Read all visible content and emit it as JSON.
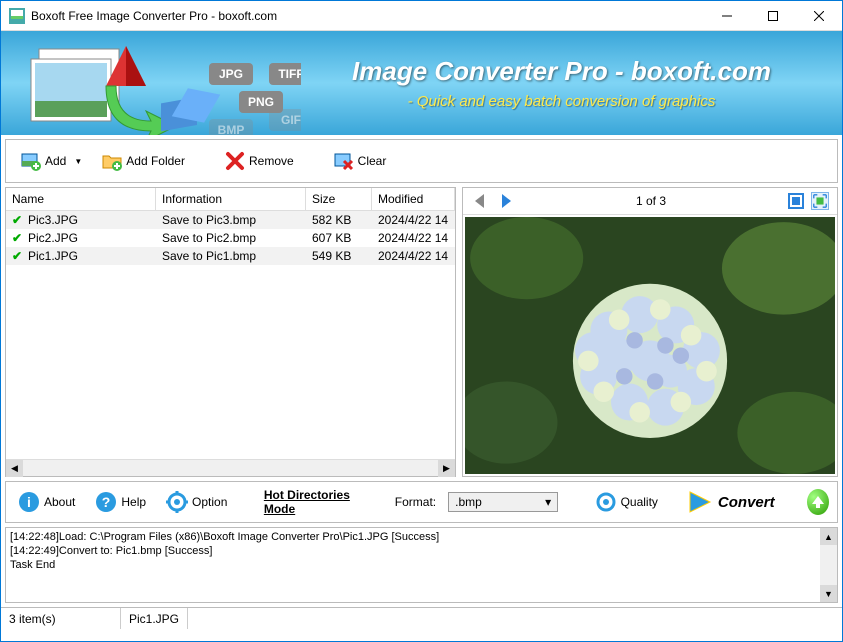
{
  "window": {
    "title": "Boxoft Free Image Converter Pro - boxoft.com"
  },
  "banner": {
    "title": "Image Converter Pro - boxoft.com",
    "subtitle": "- Quick and easy batch conversion of graphics"
  },
  "toolbar": {
    "add": "Add",
    "add_folder": "Add Folder",
    "remove": "Remove",
    "clear": "Clear"
  },
  "file_list": {
    "headers": {
      "name": "Name",
      "info": "Information",
      "size": "Size",
      "modified": "Modified"
    },
    "rows": [
      {
        "name": "Pic3.JPG",
        "info": "Save to Pic3.bmp",
        "size": "582 KB",
        "modified": "2024/4/22 14"
      },
      {
        "name": "Pic2.JPG",
        "info": "Save to Pic2.bmp",
        "size": "607 KB",
        "modified": "2024/4/22 14"
      },
      {
        "name": "Pic1.JPG",
        "info": "Save to Pic1.bmp",
        "size": "549 KB",
        "modified": "2024/4/22 14"
      }
    ]
  },
  "preview": {
    "counter": "1 of 3"
  },
  "bottom": {
    "about": "About",
    "help": "Help",
    "option": "Option",
    "hot_dir": "Hot Directories Mode",
    "format_label": "Format:",
    "format_value": ".bmp",
    "quality": "Quality",
    "convert": "Convert"
  },
  "log": {
    "lines": [
      "[14:22:48]Load: C:\\Program Files (x86)\\Boxoft Image Converter Pro\\Pic1.JPG [Success]",
      "[14:22:49]Convert to: Pic1.bmp [Success]",
      "Task End"
    ]
  },
  "status": {
    "count": "3 item(s)",
    "file": "Pic1.JPG"
  }
}
